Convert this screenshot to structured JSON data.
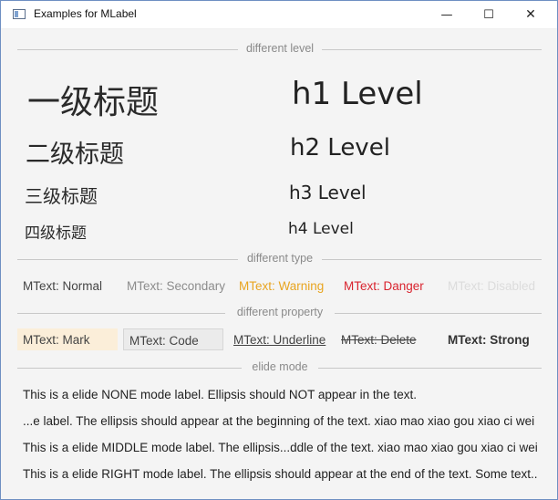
{
  "window": {
    "title": "Examples for MLabel",
    "minimize": "—",
    "maximize": "☐",
    "close": "✕"
  },
  "sections": {
    "level": "different level",
    "type": "different type",
    "property": "different property",
    "elide": "elide mode"
  },
  "levels": {
    "cn1": "一级标题",
    "cn2": "二级标题",
    "cn3": "三级标题",
    "cn4": "四级标题",
    "en1": "h1 Level",
    "en2": "h2 Level",
    "en3": "h3 Level",
    "en4": "h4 Level"
  },
  "types": {
    "normal": "MText: Normal",
    "secondary": "MText: Secondary",
    "warning": "MText: Warning",
    "danger": "MText: Danger",
    "disabled": "MText: Disabled"
  },
  "properties": {
    "mark": "MText: Mark",
    "code": "MText: Code",
    "underline": "MText: Underline",
    "delete": "MText: Delete",
    "strong": "MText: Strong"
  },
  "elide": {
    "none": "This is a elide NONE mode label. Ellipsis should NOT appear in the text.",
    "left": "...e label. The ellipsis should appear at the beginning of the text. xiao mao xiao gou xiao ci wei",
    "middle": "This is a elide MIDDLE mode label. The ellipsis...ddle of the text. xiao mao xiao gou xiao ci wei",
    "right": "This is a elide RIGHT mode label. The ellipsis should appear at the end of the text. Some text.."
  },
  "colors": {
    "normal": "#444444",
    "secondary": "#8c8c8c",
    "warning": "#e8a521",
    "danger": "#d9242f",
    "disabled": "#dcdcdc",
    "mark_bg": "#fbeed9",
    "code_bg": "#ebebeb",
    "window_border": "#6e8fc2"
  }
}
